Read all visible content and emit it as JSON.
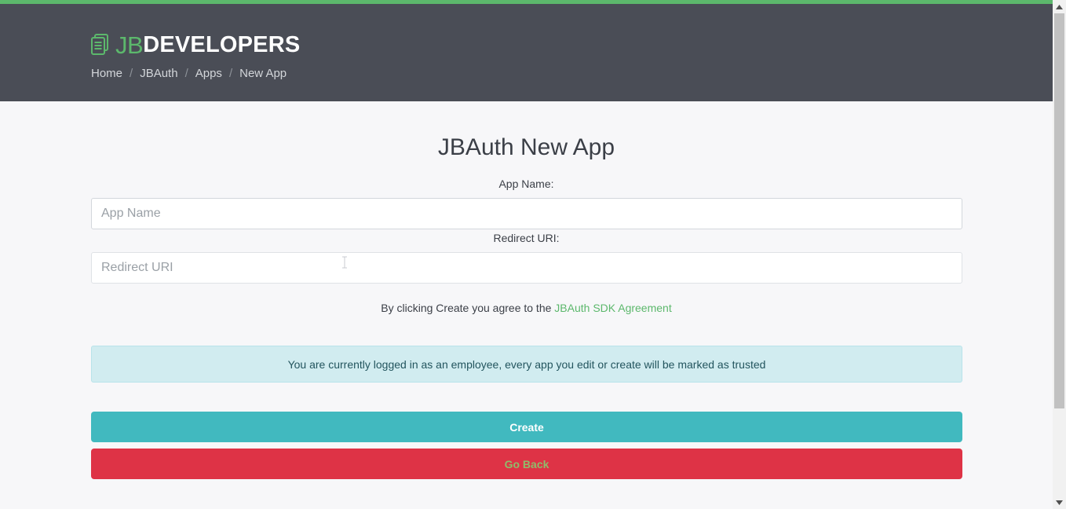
{
  "colors": {
    "accent": "#5cb86c",
    "header_bg": "#4a4d56",
    "info_bg": "#d1ecf0",
    "create_bg": "#41b9bf",
    "back_bg": "#de3346"
  },
  "header": {
    "brand_icon": "document-icon",
    "brand_prefix": "JB",
    "brand_suffix": "DEVELOPERS",
    "breadcrumb": [
      "Home",
      "JBAuth",
      "Apps",
      "New App"
    ],
    "breadcrumb_separator": "/"
  },
  "main": {
    "title": "JBAuth New App",
    "app_name_label": "App Name:",
    "app_name_placeholder": "App Name",
    "app_name_value": "",
    "redirect_label": "Redirect URI:",
    "redirect_placeholder": "Redirect URI",
    "redirect_value": "",
    "agreement_text": "By clicking Create you agree to the",
    "agreement_link": "JBAuth SDK Agreement",
    "notice": "You are currently logged in as an employee, every app you edit or create will be marked as trusted",
    "create_label": "Create",
    "back_label": "Go Back"
  }
}
